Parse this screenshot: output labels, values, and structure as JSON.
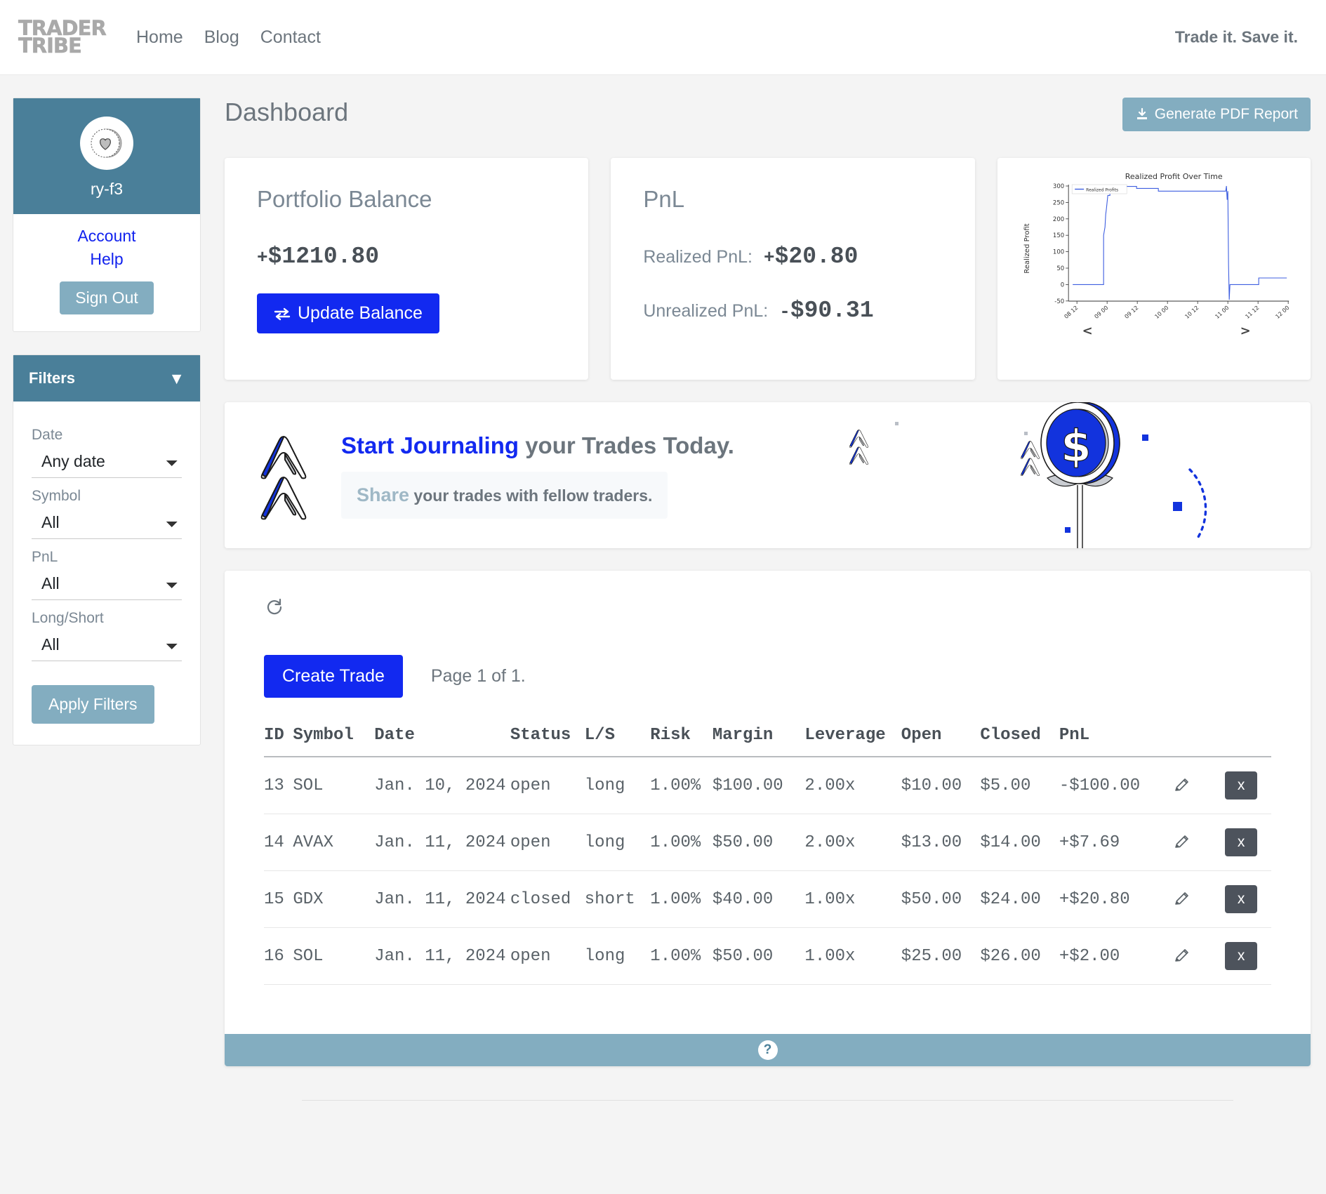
{
  "nav": {
    "brand_line1": "TRADER",
    "brand_line2": "TRIBE",
    "links": [
      {
        "label": "Home"
      },
      {
        "label": "Blog"
      },
      {
        "label": "Contact"
      }
    ],
    "tagline": "Trade it. Save it."
  },
  "sidebar": {
    "profile": {
      "username": "ry-f3",
      "avatar_icon": "heart-badge-icon",
      "account_label": "Account",
      "help_label": "Help",
      "signout_label": "Sign Out"
    },
    "filters": {
      "title": "Filters",
      "caret_icon": "chevron-down-icon",
      "fields": [
        {
          "label": "Date",
          "value": "Any date",
          "options": [
            "Any date"
          ]
        },
        {
          "label": "Symbol",
          "value": "All",
          "options": [
            "All"
          ]
        },
        {
          "label": "PnL",
          "value": "All",
          "options": [
            "All"
          ]
        },
        {
          "label": "Long/Short",
          "value": "All",
          "options": [
            "All"
          ]
        }
      ],
      "apply_label": "Apply Filters"
    }
  },
  "header": {
    "title": "Dashboard",
    "pdf_button_label": "Generate PDF Report",
    "pdf_button_icon": "download-icon"
  },
  "balance_card": {
    "title": "Portfolio Balance",
    "sign": "+",
    "value": "$1210.80",
    "button_label": "Update Balance",
    "button_icon": "exchange-arrows-icon"
  },
  "pnl_card": {
    "title": "PnL",
    "realized_label": "Realized PnL:",
    "realized_sign": "+",
    "realized_value": "$20.80",
    "unrealized_label": "Unrealized PnL:",
    "unrealized_sign": "-",
    "unrealized_value": "$90.31"
  },
  "chart_data": {
    "type": "line",
    "title": "Realized Profit Over Time",
    "xlabel": "",
    "ylabel": "Realized Profit",
    "legend": [
      "Realized Profits"
    ],
    "legend_position": "upper left",
    "grid": false,
    "line_color": "#3f5fe0",
    "ylim": [
      -50,
      300
    ],
    "yticks": [
      -50,
      0,
      50,
      100,
      150,
      200,
      250,
      300
    ],
    "xticks": [
      "08 12",
      "09 00",
      "09 12",
      "10 00",
      "10 12",
      "11 00",
      "11 12",
      "12 00"
    ],
    "x": [
      0,
      0.33,
      0.36,
      0.37,
      0.38,
      0.39,
      0.4,
      0.43,
      0.6,
      0.62,
      0.8,
      0.815,
      0.82,
      0.825,
      0.83,
      0.835,
      0.84,
      0.93,
      0.95,
      1.0
    ],
    "values": [
      0,
      0,
      150,
      175,
      215,
      232,
      273,
      273,
      273,
      263,
      263,
      300,
      233,
      263,
      60,
      -46,
      0,
      0,
      20,
      21
    ],
    "prev_label": "<",
    "next_label": ">"
  },
  "banner": {
    "heading_blue": "Start Journaling",
    "heading_rest": " your Trades Today.",
    "sub_strong": "Share",
    "sub_rest": " your trades with fellow traders.",
    "logo_icon": "double-chevron-logo-icon",
    "art_icon": "dollar-coin-lollipop-icon"
  },
  "trades": {
    "refresh_icon": "refresh-icon",
    "create_label": "Create Trade",
    "page_info": "Page 1 of 1.",
    "columns": [
      "ID",
      "Symbol",
      "Date",
      "Status",
      "L/S",
      "Risk",
      "Margin",
      "Leverage",
      "Open",
      "Closed",
      "PnL"
    ],
    "rows": [
      {
        "id": "13",
        "symbol": "SOL",
        "date": "Jan. 10, 2024",
        "status": "open",
        "ls": "long",
        "risk": "1.00%",
        "margin": "$100.00",
        "leverage": "2.00x",
        "open": "$10.00",
        "closed": "$5.00",
        "pnl": "-$100.00",
        "edit_icon": "pencil-icon",
        "delete_label": "x"
      },
      {
        "id": "14",
        "symbol": "AVAX",
        "date": "Jan. 11, 2024",
        "status": "open",
        "ls": "long",
        "risk": "1.00%",
        "margin": "$50.00",
        "leverage": "2.00x",
        "open": "$13.00",
        "closed": "$14.00",
        "pnl": "+$7.69",
        "edit_icon": "pencil-icon",
        "delete_label": "x"
      },
      {
        "id": "15",
        "symbol": "GDX",
        "date": "Jan. 11, 2024",
        "status": "closed",
        "ls": "short",
        "risk": "1.00%",
        "margin": "$40.00",
        "leverage": "1.00x",
        "open": "$50.00",
        "closed": "$24.00",
        "pnl": "+$20.80",
        "edit_icon": "pencil-icon",
        "delete_label": "x"
      },
      {
        "id": "16",
        "symbol": "SOL",
        "date": "Jan. 11, 2024",
        "status": "open",
        "ls": "long",
        "risk": "1.00%",
        "margin": "$50.00",
        "leverage": "1.00x",
        "open": "$25.00",
        "closed": "$26.00",
        "pnl": "+$2.00",
        "edit_icon": "pencil-icon",
        "delete_label": "x"
      }
    ],
    "help_icon": "question-mark-icon",
    "help_label": "?"
  },
  "colors": {
    "accent_blue": "#1229f0",
    "muted_blue": "#83adc0",
    "header_blue": "#4a7f99",
    "text_gray": "#6c757d",
    "dark_button": "#4d535c"
  }
}
